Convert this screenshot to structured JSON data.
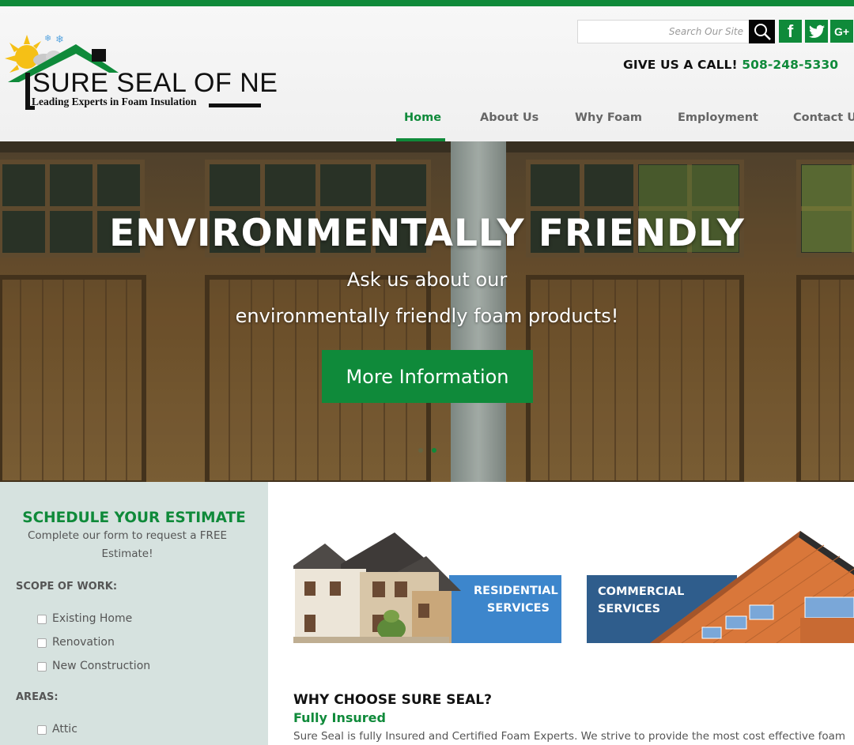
{
  "brand": {
    "name": "SURE SEAL OF NE",
    "tagline": "Leading Experts in Foam Insulation"
  },
  "search": {
    "placeholder": "Search Our Site"
  },
  "social": {
    "facebook": "f",
    "twitter": "twitter-icon",
    "google_plus": "G+"
  },
  "call": {
    "label": "GIVE US A CALL!",
    "phone": "508-248-5330"
  },
  "nav": {
    "items": [
      {
        "label": "Home",
        "active": true
      },
      {
        "label": "About Us"
      },
      {
        "label": "Why Foam"
      },
      {
        "label": "Employment"
      },
      {
        "label": "Contact Us"
      }
    ]
  },
  "hero": {
    "title": "ENVIRONMENTALLY FRIENDLY",
    "line1": "Ask us about our",
    "line2": "environmentally friendly foam products!",
    "button": "More Information",
    "slides": 2,
    "active_slide": 2
  },
  "estimate_form": {
    "title": "SCHEDULE YOUR ESTIMATE",
    "description": "Complete our form to request a FREE Estimate!",
    "scope_label": "SCOPE OF WORK:",
    "scope_options": [
      "Existing Home",
      "Renovation",
      "New Construction"
    ],
    "areas_label": "AREAS:",
    "area_options": [
      "Attic"
    ]
  },
  "services": {
    "residential": "RESIDENTIAL SERVICES",
    "residential_l1": "RESIDENTIAL",
    "residential_l2": "SERVICES",
    "commercial": "COMMERCIAL SERVICES",
    "commercial_l1": "COMMERCIAL",
    "commercial_l2": "SERVICES"
  },
  "why": {
    "title": "WHY CHOOSE SURE SEAL?",
    "subtitle": "Fully Insured",
    "text": "Sure Seal is fully Insured and Certified Foam Experts. We strive to provide the most cost effective foam"
  },
  "colors": {
    "brand_green": "#0f8a3a",
    "sidebar_bg": "#d6e2df",
    "service_blue": "#4a8fd1",
    "service_navy": "#2f5d8c"
  }
}
